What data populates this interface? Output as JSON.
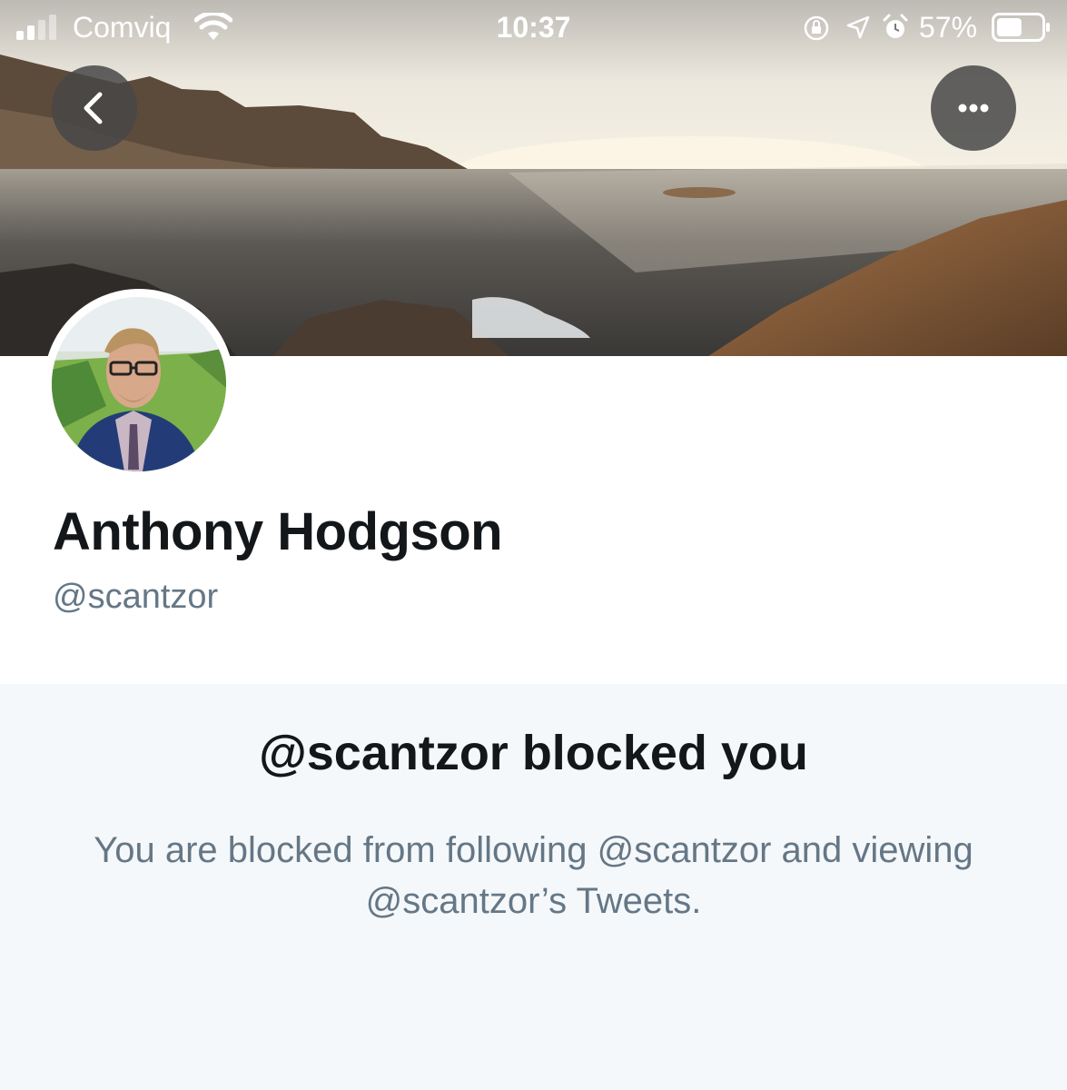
{
  "status_bar": {
    "carrier": "Comviq",
    "time": "10:37",
    "battery_percent": "57%",
    "battery_level": 0.57,
    "icons": [
      "signal-icon",
      "wifi-icon",
      "rotation-lock-icon",
      "location-arrow-icon",
      "alarm-icon",
      "battery-icon"
    ]
  },
  "header": {
    "back_icon": "chevron-left-icon",
    "more_icon": "more-dots-icon"
  },
  "profile": {
    "display_name": "Anthony Hodgson",
    "handle": "@scantzor"
  },
  "blocked_notice": {
    "title": "@scantzor blocked you",
    "description": "You are blocked from following @scantzor and viewing @scantzor’s Tweets."
  },
  "colors": {
    "primary_text": "#14171a",
    "secondary_text": "#657786",
    "panel_background": "#f5f8fa"
  }
}
